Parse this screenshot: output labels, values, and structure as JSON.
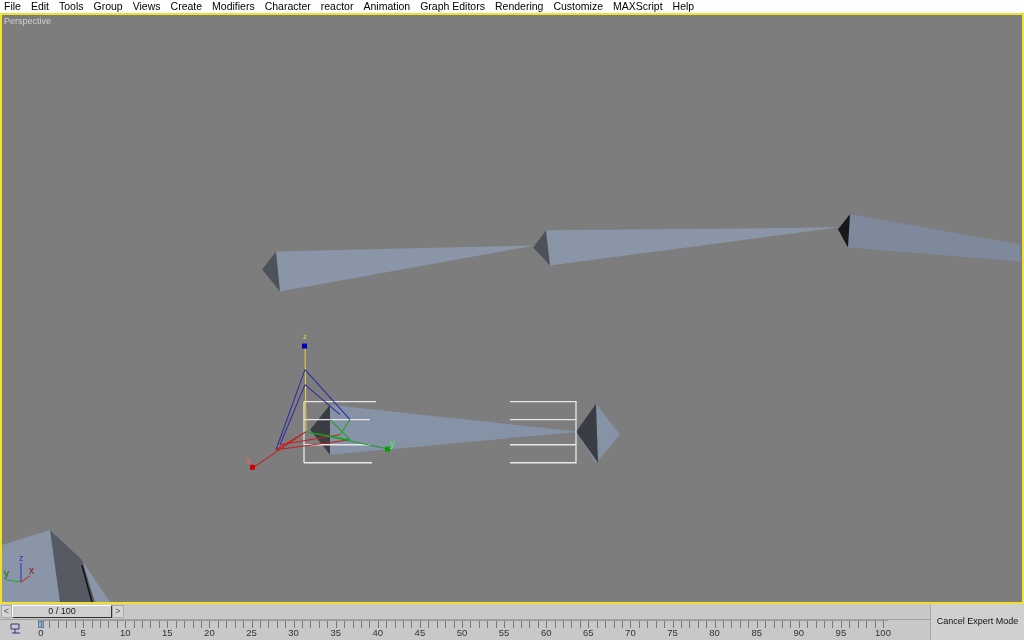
{
  "menu_bar": [
    {
      "label": "File"
    },
    {
      "label": "Edit"
    },
    {
      "label": "Tools"
    },
    {
      "label": "Group"
    },
    {
      "label": "Views"
    },
    {
      "label": "Create"
    },
    {
      "label": "Modifiers"
    },
    {
      "label": "Character"
    },
    {
      "label": "reactor"
    },
    {
      "label": "Animation"
    },
    {
      "label": "Graph Editors"
    },
    {
      "label": "Rendering"
    },
    {
      "label": "Customize"
    },
    {
      "label": "MAXScript"
    },
    {
      "label": "Help"
    }
  ],
  "viewport": {
    "label": "Perspective",
    "active": true,
    "gizmo_axes": [
      "z",
      "x",
      "y"
    ],
    "corner_axes": [
      "z",
      "y",
      "x"
    ]
  },
  "time_slider": {
    "prev": "<",
    "frame": "0 / 100",
    "next": ">",
    "level": 0
  },
  "track_bar": {
    "ticks": [
      "0",
      "5",
      "10",
      "15",
      "20",
      "25",
      "30",
      "35",
      "40",
      "45",
      "50",
      "55",
      "60",
      "65",
      "70",
      "75",
      "80",
      "85",
      "90",
      "95",
      "100"
    ]
  },
  "expert_mode_button": "Cancel Expert Mode"
}
